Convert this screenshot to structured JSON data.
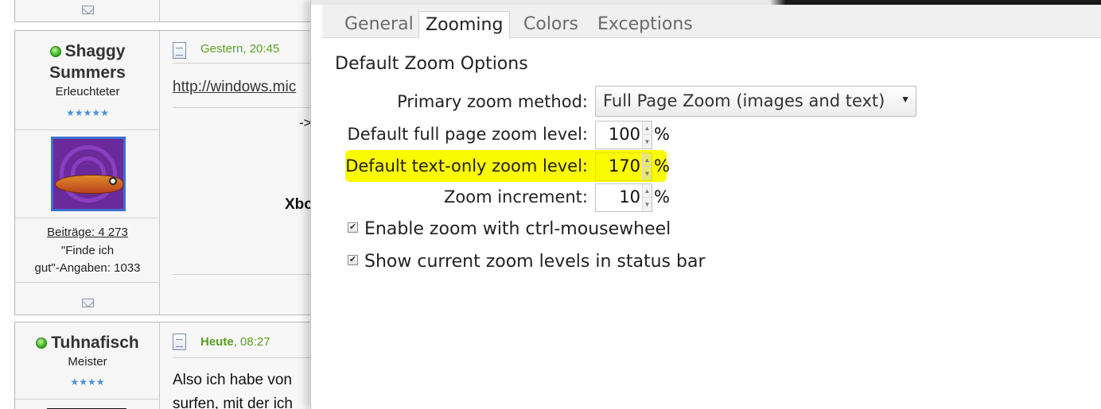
{
  "forum": {
    "post1": {
      "username": "Shaggy Summers",
      "username_line1": "Shaggy",
      "username_line2": "Summers",
      "rank": "Erleuchteter",
      "stars": "★★★★★",
      "posts": "Beiträge: 4 273",
      "likes_line1": "\"Finde ich",
      "likes_line2": "gut\"-Angaben: 1033",
      "date": "Gestern, 20:45",
      "link": "http://windows.mic",
      "arrow": "->",
      "bold": "Xbo"
    },
    "post2": {
      "username": "Tuhnafisch",
      "rank": "Meister",
      "stars": "★★★★",
      "date_bold": "Heute",
      "date_rest": ", 08:27",
      "text1": "Also ich habe von",
      "text2": "surfen, mit der ich"
    }
  },
  "dialog": {
    "tabs": [
      {
        "label": "General"
      },
      {
        "label": "Zooming"
      },
      {
        "label": "Colors"
      },
      {
        "label": "Exceptions"
      }
    ],
    "active_tab": "Zooming",
    "section_title": "Default Zoom Options",
    "primary_label": "Primary zoom method:",
    "primary_value": "Full Page Zoom (images and text)",
    "full_label": "Default full page zoom level:",
    "full_value": "100",
    "text_label": "Default text-only zoom level:",
    "text_value": "170",
    "incr_label": "Zoom increment:",
    "incr_value": "10",
    "percent": "%",
    "check1_label": "Enable zoom with ctrl-mousewheel",
    "check2_label": "Show current zoom levels in status bar",
    "check1_checked": true,
    "check2_checked": true,
    "highlight_color": "#fbfb00"
  }
}
